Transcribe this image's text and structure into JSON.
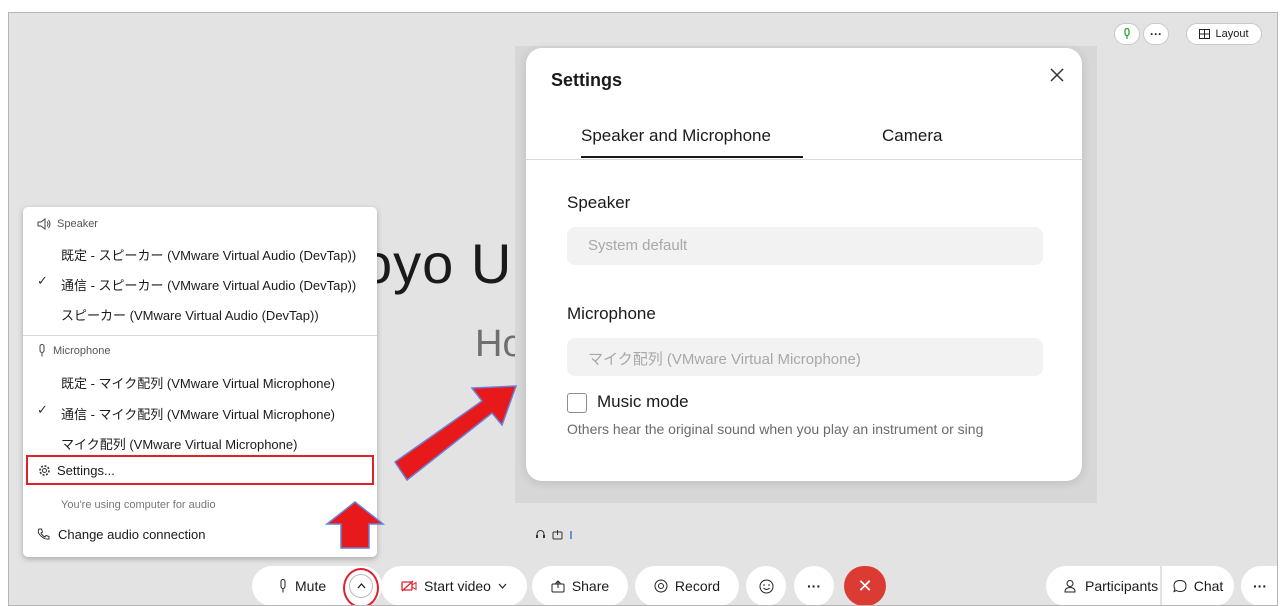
{
  "colors": {
    "stage_bg": "#e3e3e3",
    "accent_red": "#e0202a",
    "end_call_red": "#dc3b34",
    "annotation_arrow": "#e8191a"
  },
  "top_controls": {
    "mic_icon": "mic-icon",
    "more_label": "···",
    "layout_label": "Layout",
    "layout_icon": "grid-icon"
  },
  "meeting": {
    "title_partial": "oyo U",
    "subtitle_partial": "Ho"
  },
  "settings_dialog": {
    "title": "Settings",
    "close_icon": "close-icon",
    "tabs": [
      {
        "label": "Speaker and Microphone",
        "active": true
      },
      {
        "label": "Camera",
        "active": false
      }
    ],
    "speaker_label": "Speaker",
    "speaker_value": "System default",
    "microphone_label": "Microphone",
    "microphone_value": "マイク配列 (VMware Virtual Microphone)",
    "music_mode_label": "Music mode",
    "music_mode_checked": false,
    "music_mode_desc": "Others hear the original sound when you play an instrument or sing"
  },
  "audio_menu": {
    "speaker_header": "Speaker",
    "speakers": [
      {
        "label": "既定 - スピーカー (VMware Virtual Audio (DevTap))",
        "checked": false
      },
      {
        "label": "通信 - スピーカー (VMware Virtual Audio (DevTap))",
        "checked": true
      },
      {
        "label": "スピーカー (VMware Virtual Audio (DevTap))",
        "checked": false
      }
    ],
    "microphone_header": "Microphone",
    "microphones": [
      {
        "label": "既定 - マイク配列 (VMware Virtual Microphone)",
        "checked": false
      },
      {
        "label": "通信 - マイク配列 (VMware Virtual Microphone)",
        "checked": true
      },
      {
        "label": "マイク配列 (VMware Virtual Microphone)",
        "checked": false
      }
    ],
    "settings_label": "Settings...",
    "audio_note": "You're using computer for audio",
    "change_audio_label": "Change audio connection"
  },
  "toolbar": {
    "mute_label": "Mute",
    "chevron_label": "^",
    "start_video_label": "Start video",
    "share_label": "Share",
    "record_label": "Record",
    "more_label": "···",
    "end_label": "✕",
    "participants_label": "Participants",
    "chat_label": "Chat",
    "right_more_label": "···"
  }
}
